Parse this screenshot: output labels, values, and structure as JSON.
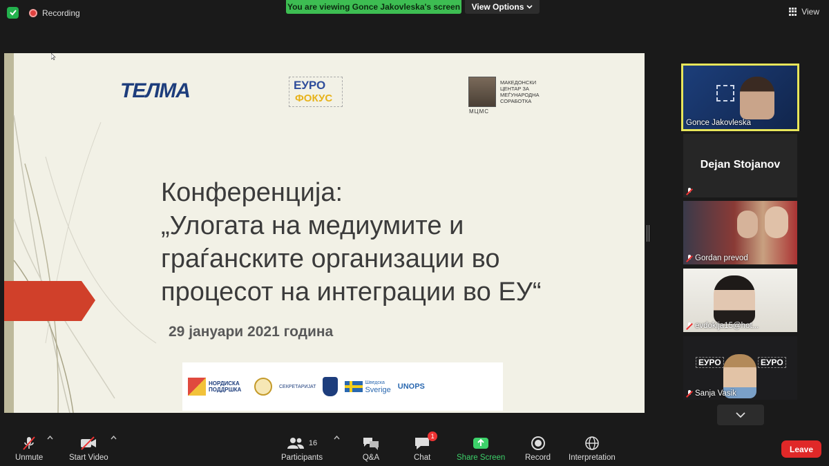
{
  "top": {
    "recording": "Recording",
    "viewing": "You are viewing Gonce Jakovleska's screen",
    "view_options": "View Options",
    "view": "View"
  },
  "slide": {
    "logo_telma": "ТЕЛМА",
    "logo_euro_top": "ЕУРО",
    "logo_euro_bottom": "ФОКУС",
    "mcms_text": "Македонски центар за меѓународна соработка",
    "mcms_abbr": "МЦМС",
    "title": "Конференција:\n„Улогата на медиумите и\nграѓанските организации во\nпроцесот на интеграции во ЕУ“",
    "date": "29 јануари 2021 година",
    "sponsors": {
      "nord": "НОРДИСКА ПОДДРШКА",
      "secretariat": "СЕКРЕТАРИЈАТ",
      "sverige_top": "Шведска",
      "sverige": "Sverige",
      "unops": "UNOPS"
    }
  },
  "participants": [
    {
      "name": "Gonce Jakovleska",
      "muted": false,
      "active_speaker": true
    },
    {
      "name": "Dejan Stojanov",
      "muted": true,
      "video": false
    },
    {
      "name": "Gordan prevod",
      "muted": true
    },
    {
      "name": "evdokija15@hot...",
      "muted": true
    },
    {
      "name": "Sanja Vasik",
      "muted": true
    }
  ],
  "participant_tile_euro_left": "ЕУРО",
  "participant_tile_euro_right": "ЕУРО",
  "toolbar": {
    "unmute": "Unmute",
    "start_video": "Start Video",
    "participants": "Participants",
    "participants_count": "16",
    "qa": "Q&A",
    "chat": "Chat",
    "chat_badge": "1",
    "share_screen": "Share Screen",
    "record": "Record",
    "interpretation": "Interpretation",
    "leave": "Leave"
  },
  "colors": {
    "active_speaker_border": "#e8e65a",
    "share_green": "#3dd16a",
    "leave_red": "#e02828",
    "viewing_banner": "#3dbd52"
  }
}
